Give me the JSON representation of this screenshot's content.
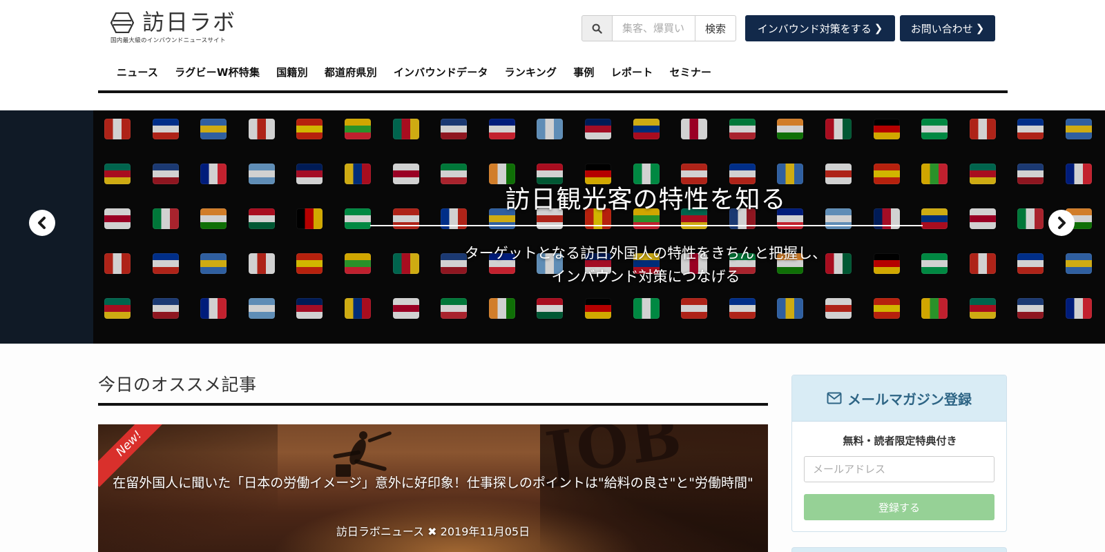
{
  "header": {
    "logo_text": "訪日ラボ",
    "logo_tagline": "国内最大級のインバウンドニュースサイト",
    "search": {
      "placeholder": "集客、爆買い",
      "button_label": "検索",
      "icon": "search-icon"
    },
    "cta_inbound_label": "インバウンド対策をする",
    "cta_contact_label": "お問い合わせ",
    "chevron_icon": "chevron-right-icon",
    "accent_color": "#12294a"
  },
  "nav": {
    "items": [
      {
        "label": "ニュース"
      },
      {
        "label": "ラグビーW杯特集"
      },
      {
        "label": "国籍別"
      },
      {
        "label": "都道府県別"
      },
      {
        "label": "インバウンドデータ"
      },
      {
        "label": "ランキング"
      },
      {
        "label": "事例"
      },
      {
        "label": "レポート"
      },
      {
        "label": "セミナー"
      }
    ]
  },
  "hero": {
    "title": "訪日観光客の特性を知る",
    "subtitle_line1": "ターゲットとなる訪日外国人の特性をきちんと把握し、",
    "subtitle_line2": "インバウンド対策につなげる",
    "prev_icon": "chevron-left-icon",
    "next_icon": "chevron-right-icon"
  },
  "main": {
    "section_title": "今日のオススメ記事",
    "featured": {
      "badge": "New!",
      "title": "在留外国人に聞いた「日本の労働イメージ」意外に好印象！仕事探しのポイントは\"給料の良さ\"と\"労働時間\"",
      "source": "訪日ラボニュース",
      "separator_icon": "cross-icon",
      "date": "2019年11月05日",
      "image_text": "JOB"
    }
  },
  "sidebar": {
    "newsletter": {
      "title": "メールマガジン登録",
      "icon": "envelope-icon",
      "subtitle": "無料・読者限定特典付き",
      "email_placeholder": "メールアドレス",
      "submit_label": "登録する",
      "header_color": "#d9ecf5",
      "submit_color": "#96d196"
    }
  }
}
